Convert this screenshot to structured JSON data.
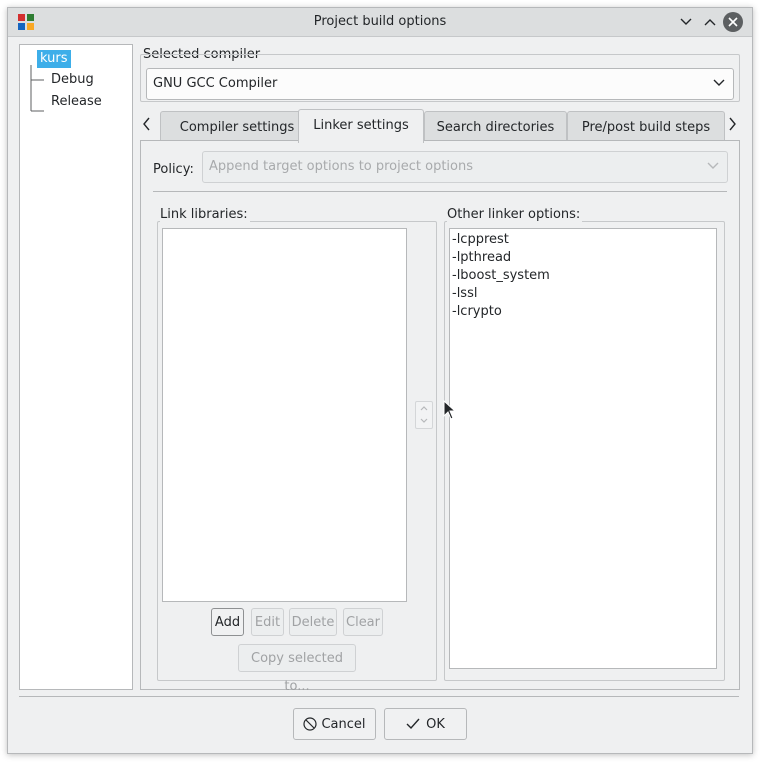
{
  "window": {
    "title": "Project build options"
  },
  "tree": {
    "items": [
      "kurs",
      "Debug",
      "Release"
    ]
  },
  "compiler": {
    "group_label": "Selected compiler",
    "selected": "GNU GCC Compiler"
  },
  "tabs": [
    "Compiler settings",
    "Linker settings",
    "Search directories",
    "Pre/post build steps"
  ],
  "policy": {
    "label": "Policy:",
    "value": "Append target options to project options"
  },
  "link_libraries": {
    "label": "Link libraries:",
    "buttons": {
      "add": "Add",
      "edit": "Edit",
      "delete": "Delete",
      "clear": "Clear",
      "copy": "Copy selected to..."
    }
  },
  "other_linker": {
    "label": "Other linker options:",
    "lines": [
      "-lcpprest",
      "-lpthread",
      "-lboost_system",
      "-lssl",
      "-lcrypto"
    ]
  },
  "footer": {
    "cancel": "Cancel",
    "ok": "OK"
  },
  "colors": {
    "selection": "#3daee9",
    "window_bg": "#eff0f1"
  }
}
